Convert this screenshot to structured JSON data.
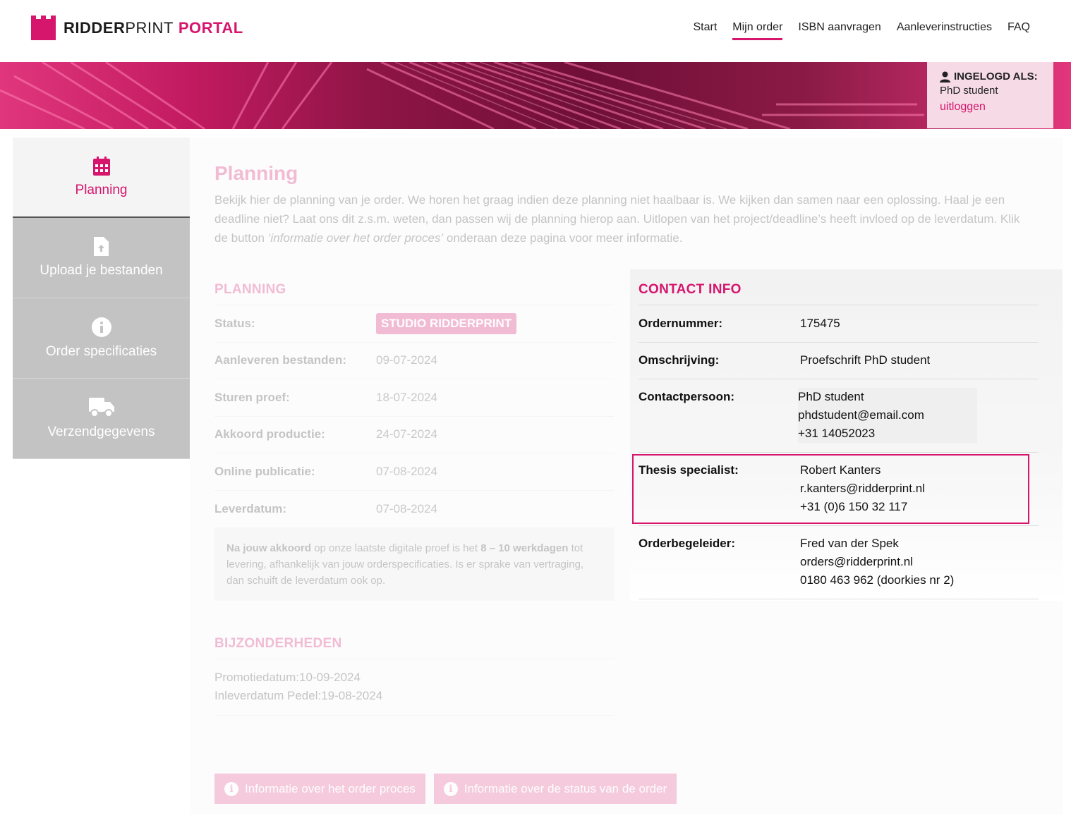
{
  "header": {
    "logo": {
      "part1": "RIDDER",
      "part2": "PRINT",
      "part3": "PORTAL"
    },
    "nav": [
      {
        "label": "Start",
        "active": false
      },
      {
        "label": "Mijn order",
        "active": true
      },
      {
        "label": "ISBN aanvragen",
        "active": false
      },
      {
        "label": "Aanleverinstructies",
        "active": false
      },
      {
        "label": "FAQ",
        "active": false
      }
    ]
  },
  "login": {
    "title": "INGELOGD ALS:",
    "name": "PhD student",
    "logout": "uitloggen",
    "icon": "user-icon"
  },
  "sidebar": {
    "items": [
      {
        "label": "Planning",
        "icon": "calendar-icon",
        "active": true
      },
      {
        "label": "Upload je bestanden",
        "icon": "file-upload-icon",
        "active": false
      },
      {
        "label": "Order specificaties",
        "icon": "info-icon",
        "active": false
      },
      {
        "label": "Verzendgegevens",
        "icon": "truck-icon",
        "active": false
      }
    ]
  },
  "main": {
    "title": "Planning",
    "intro_part1": "Bekijk hier de planning van je order. We horen het graag indien deze planning niet haalbaar is. We kijken dan samen naar een oplossing. Haal je een deadline niet? Laat ons dit z.s.m. weten, dan passen wij de planning hierop aan. Uitlopen van het project/deadline’s heeft invloed op de leverdatum. Klik de button",
    "intro_italic": "‘informatie over het order proces’",
    "intro_part2": "onderaan deze pagina voor meer informatie."
  },
  "planning": {
    "heading": "PLANNING",
    "rows": [
      {
        "label": "Status:",
        "value": "STUDIO RIDDERPRINT"
      },
      {
        "label": "Aanleveren bestanden:",
        "value": "09-07-2024"
      },
      {
        "label": "Sturen proef:",
        "value": "18-07-2024"
      },
      {
        "label": "Akkoord productie:",
        "value": "24-07-2024"
      },
      {
        "label": "Online publicatie:",
        "value": "07-08-2024"
      },
      {
        "label": "Leverdatum:",
        "value": "07-08-2024"
      }
    ],
    "note": {
      "bold1": "Na jouw akkoord",
      "text1": " op onze laatste digitale proef is het ",
      "bold2": "8 – 10 werkdagen",
      "text2": " tot levering, afhankelijk van jouw orderspecificaties. Is er sprake van vertraging, dan schuift de leverdatum ook op."
    }
  },
  "bijzonderheden": {
    "heading": "BIJZONDERHEDEN",
    "line1": "Promotiedatum:10-09-2024",
    "line2": "Inleverdatum Pedel:19-08-2024"
  },
  "buttons": {
    "info_process": "Informatie over het order proces",
    "info_status": "Informatie over de status van de order"
  },
  "contact": {
    "heading": "CONTACT INFO",
    "ordernummer_label": "Ordernummer:",
    "ordernummer": "175475",
    "omschrijving_label": "Omschrijving:",
    "omschrijving": "Proefschrift PhD student",
    "contactpersoon_label": "Contactpersoon:",
    "contactpersoon": {
      "name": "PhD student",
      "email": "phdstudent@email.com",
      "phone": "+31 14052023"
    },
    "specialist_label": "Thesis specialist:",
    "specialist": {
      "name": "Robert Kanters",
      "email": "r.kanters@ridderprint.nl",
      "phone": "+31 (0)6 150 32 117"
    },
    "begeleider_label": "Orderbegeleider:",
    "begeleider": {
      "name": "Fred van der Spek",
      "email": "orders@ridderprint.nl",
      "phone": "0180 463 962 (doorkies nr 2)"
    }
  },
  "colors": {
    "brand": "#d6156d",
    "login_bg": "#f6dbe6",
    "sidebar_inactive": "#c3c3c3"
  }
}
